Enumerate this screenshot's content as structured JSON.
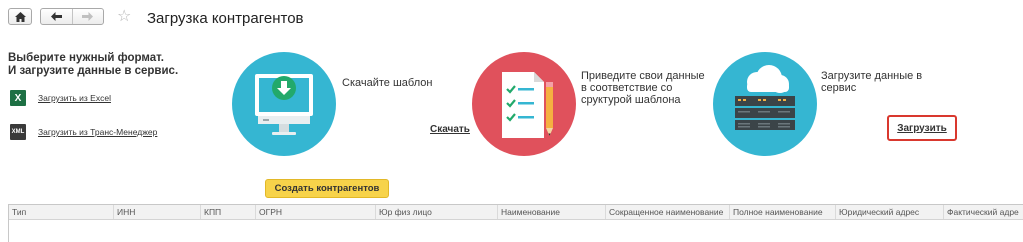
{
  "header": {
    "home_icon": "home-icon",
    "back_icon": "arrow-left-icon",
    "forward_icon": "arrow-right-icon",
    "favorite_icon": "star-icon",
    "title": "Загрузка контрагентов"
  },
  "intro": {
    "line1": "Выберите нужный формат.",
    "line2": "И загрузите данные в сервис."
  },
  "formats": [
    {
      "icon": "excel-icon",
      "badge": "X",
      "label": "Загрузить из Excel",
      "color": "#1d7044"
    },
    {
      "icon": "xml-icon",
      "badge": "XML",
      "label": "Загрузить из Транс-Менеджер",
      "color": "#3a3a3a"
    }
  ],
  "steps": [
    {
      "icon": "download-monitor-icon",
      "color": "#35b6d2",
      "text": [
        "Скачайте шаблон"
      ],
      "link": "Скачать"
    },
    {
      "icon": "checklist-pencil-icon",
      "color": "#e0515c",
      "text": [
        "Приведите свои данные",
        "в соответствие со",
        "сруктурой шаблона"
      ]
    },
    {
      "icon": "cloud-server-icon",
      "color": "#35b6d2",
      "text": [
        "Загрузите данные в",
        "сервис"
      ],
      "link": "Загрузить"
    }
  ],
  "create_button": "Создать контрагентов",
  "table": {
    "columns": [
      "Тип",
      "ИНН",
      "КПП",
      "ОГРН",
      "Юр физ лицо",
      "Наименование",
      "Сокращенное наименование",
      "Полное наименование",
      "Юридический адрес",
      "Фактический адре"
    ]
  }
}
